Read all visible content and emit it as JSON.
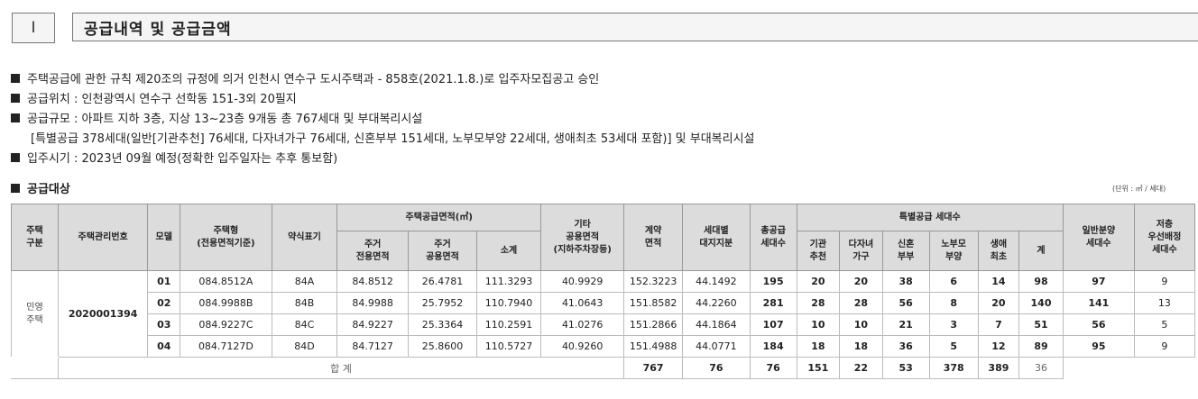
{
  "section": {
    "number": "I",
    "title": "공급내역 및 공급금액"
  },
  "info_lines": [
    "주택공급에 관한 규칙 제20조의 규정에 의거 인천시 연수구 도시주택과 - 858호(2021.1.8.)로 입주자모집공고 승인",
    "공급위치 : 인천광역시 연수구 선학동 151-3외 20필지",
    "공급규모 : 아파트 지하 3층, 지상 13~23층 9개동 총 767세대 및 부대복리시설",
    "[특별공급 378세대(일반[기관추천] 76세대, 다자녀가구 76세대, 신혼부부 151세대, 노부모부양 22세대, 생애최초 53세대 포함)] 및 부대복리시설",
    "입주시기 : 2023년 09월 예정(정확한 입주일자는 추후 통보함)"
  ],
  "target_title": "공급대상",
  "unit_note": "(단위 : ㎡ / 세대)",
  "headers": {
    "house_type_cat": [
      "주택",
      "구분"
    ],
    "mgmt_no": "주택관리번호",
    "model": "모델",
    "housing_type": [
      "주택형",
      "(전용면적기준)"
    ],
    "abbr": "약식표기",
    "supply_area": "주택공급면적(㎡)",
    "exclusive": [
      "주거",
      "전용면적"
    ],
    "common": [
      "주거",
      "공용면적"
    ],
    "subtotal": "소계",
    "other_common": [
      "기타",
      "공용면적",
      "(지하주차장등)"
    ],
    "contract_area": [
      "계약",
      "면적"
    ],
    "land_share": [
      "세대별",
      "대지지분"
    ],
    "total_supply": [
      "총공급",
      "세대수"
    ],
    "special_supply": "특별공급 세대수",
    "inst": [
      "기관",
      "추천"
    ],
    "multi_child": [
      "다자녀",
      "가구"
    ],
    "newlywed": [
      "신혼",
      "부부"
    ],
    "elderly": [
      "노부모",
      "부양"
    ],
    "first_time": [
      "생애",
      "최초"
    ],
    "special_sum": "계",
    "general": [
      "일반분양",
      "세대수"
    ],
    "low_floor": [
      "저층",
      "우선배정",
      "세대수"
    ]
  },
  "group": [
    "민영",
    "주택"
  ],
  "management_number": "2020001394",
  "rows": [
    [
      "01",
      "084.8512A",
      "84A",
      "84.8512",
      "26.4781",
      "111.3293",
      "40.9929",
      "152.3223",
      "44.1492",
      "195",
      "20",
      "20",
      "38",
      "6",
      "14",
      "98",
      "97",
      "9"
    ],
    [
      "02",
      "084.9988B",
      "84B",
      "84.9988",
      "25.7952",
      "110.7940",
      "41.0643",
      "151.8582",
      "44.2260",
      "281",
      "28",
      "28",
      "56",
      "8",
      "20",
      "140",
      "141",
      "13"
    ],
    [
      "03",
      "084.9227C",
      "84C",
      "84.9227",
      "25.3364",
      "110.2591",
      "41.0276",
      "151.2866",
      "44.1864",
      "107",
      "10",
      "10",
      "21",
      "3",
      "7",
      "51",
      "56",
      "5"
    ],
    [
      "04",
      "084.7127D",
      "84D",
      "84.7127",
      "25.8600",
      "110.5727",
      "40.9260",
      "151.4988",
      "44.0771",
      "184",
      "18",
      "18",
      "36",
      "5",
      "12",
      "89",
      "95",
      "9"
    ]
  ],
  "total": {
    "label": "합 계",
    "values": [
      "767",
      "76",
      "76",
      "151",
      "22",
      "53",
      "378",
      "389",
      "36"
    ]
  }
}
